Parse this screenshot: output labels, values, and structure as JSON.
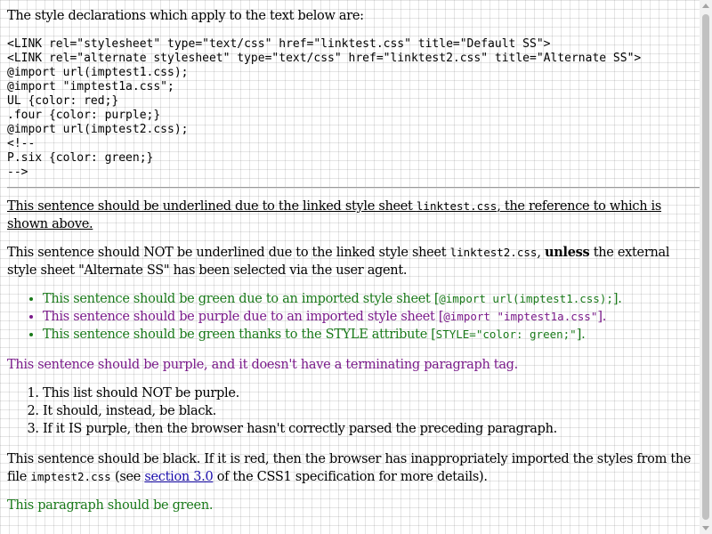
{
  "intro": "The style declarations which apply to the text below are:",
  "code_block": "<LINK rel=\"stylesheet\" type=\"text/css\" href=\"linktest.css\" title=\"Default SS\">\n<LINK rel=\"alternate stylesheet\" type=\"text/css\" href=\"linktest2.css\" title=\"Alternate SS\">\n@import url(imptest1.css);\n@import \"imptest1a.css\";\nUL {color: red;}\n.four {color: purple;}\n@import url(imptest2.css);\n<!--\nP.six {color: green;}\n-->",
  "p1": {
    "text_a": "This sentence should be underlined due to the linked style sheet ",
    "code": "linktest.css",
    "text_b": ", the reference to which is shown above."
  },
  "p2": {
    "text_a": "This sentence should NOT be underlined due to the linked style sheet ",
    "code": "linktest2.css",
    "text_b": ", ",
    "bold": "unless",
    "text_c": " the external style sheet \"Alternate SS\" has been selected via the user agent."
  },
  "bullets": [
    {
      "text": "This sentence should be green due to an imported style sheet [",
      "code": "@import url(imptest1.css);",
      "end": "]."
    },
    {
      "text": "This sentence should be purple due to an imported style sheet [",
      "code": "@import \"imptest1a.css\"",
      "end": "]."
    },
    {
      "text": "This sentence should be green thanks to the STYLE attribute [",
      "code": "STYLE=\"color: green;\"",
      "end": "]."
    }
  ],
  "p_purple": "This sentence should be purple, and it doesn't have a terminating paragraph tag.",
  "ordered": [
    "This list should NOT be purple.",
    "It should, instead, be black.",
    "If it IS purple, then the browser hasn't correctly parsed the preceding paragraph."
  ],
  "p_black": {
    "text_a": "This sentence should be black. If it is red, then the browser has inappropriately imported the styles from the file ",
    "code": "imptest2.css",
    "text_b": " (see ",
    "link": "section 3.0",
    "text_c": " of the CSS1 specification for more details)."
  },
  "p_green": "This paragraph should be green.",
  "colors": {
    "green_text": "#1a7a1a",
    "purple_text": "#7a1a8a",
    "link": "#1a0dab",
    "background_grid": "#ffffff"
  },
  "icons": {
    "scroll_up": "triangle-up-icon",
    "scroll_down": "triangle-down-icon"
  }
}
